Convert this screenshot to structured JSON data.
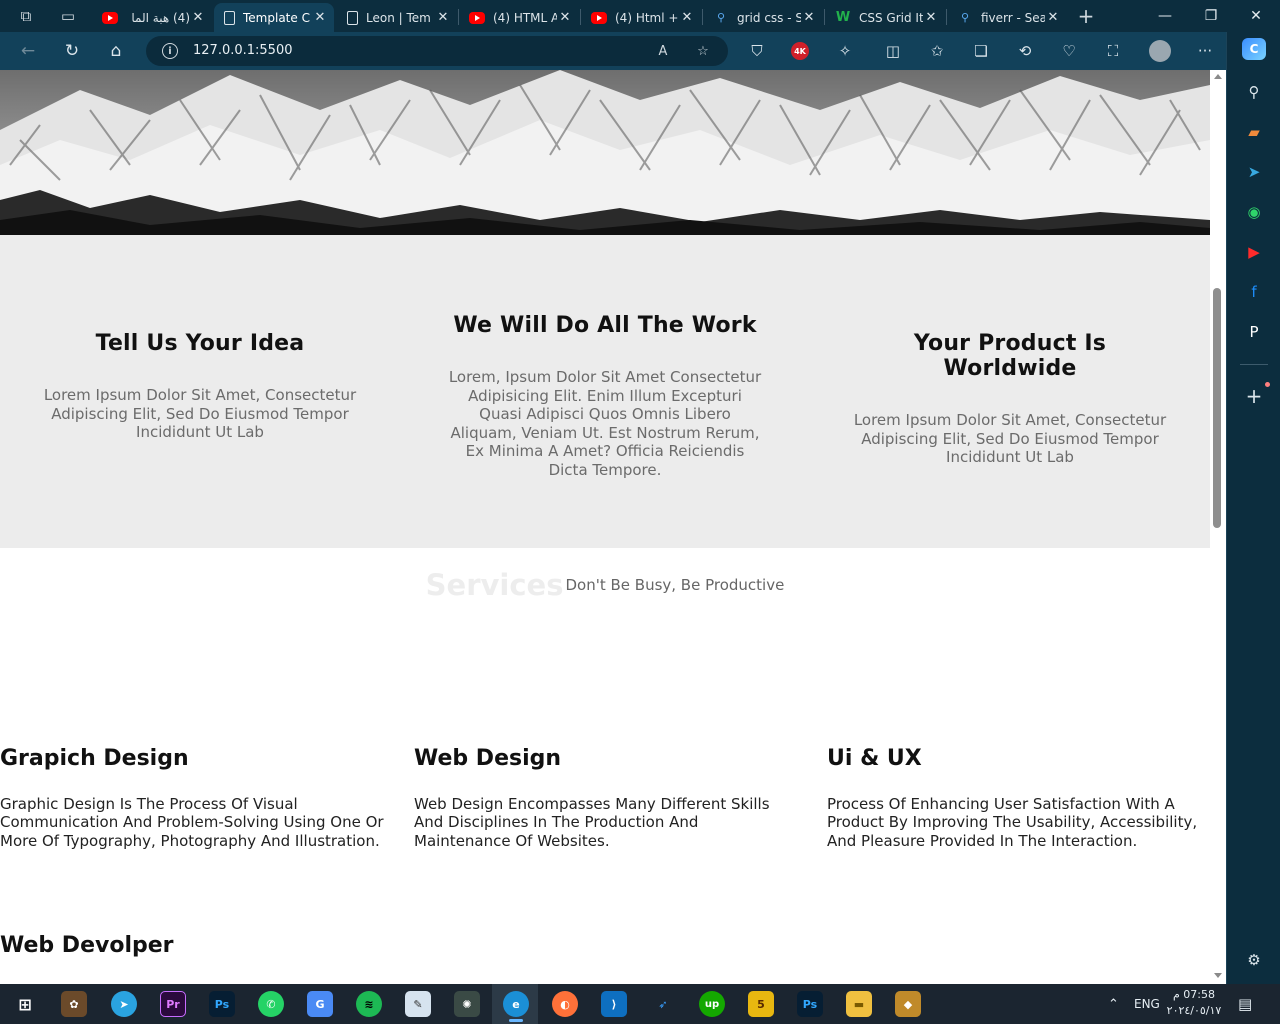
{
  "browser": {
    "tabs": [
      {
        "title": "(4) هبة الما",
        "favicon": "youtube-icon",
        "active": false
      },
      {
        "title": "Template C",
        "favicon": "document-icon",
        "active": true
      },
      {
        "title": "Leon | Tem",
        "favicon": "document-icon",
        "active": false
      },
      {
        "title": "(4) HTML A",
        "favicon": "youtube-icon",
        "active": false
      },
      {
        "title": "(4) Html +",
        "favicon": "youtube-icon",
        "active": false
      },
      {
        "title": "grid css - S",
        "favicon": "search-icon",
        "active": false
      },
      {
        "title": "CSS Grid It",
        "favicon": "w3schools-icon",
        "active": false
      },
      {
        "title": "fiverr - Sea",
        "favicon": "search-icon",
        "active": false
      }
    ],
    "address": "127.0.0.1:5500",
    "extension_badge": "4K"
  },
  "page": {
    "features": [
      {
        "title": "Tell Us Your Idea",
        "text": "Lorem Ipsum Dolor Sit Amet, Consectetur Adipiscing Elit, Sed Do Eiusmod Tempor Incididunt Ut Lab"
      },
      {
        "title": "We Will Do All The Work",
        "text": "Lorem, Ipsum Dolor Sit Amet Consectetur Adipisicing Elit. Enim Illum Excepturi Quasi Adipisci Quos Omnis Libero Aliquam, Veniam Ut. Est Nostrum Rerum, Ex Minima A Amet? Officia Reiciendis Dicta Tempore."
      },
      {
        "title": "Your Product Is Worldwide",
        "text": "Lorem Ipsum Dolor Sit Amet, Consectetur Adipiscing Elit, Sed Do Eiusmod Tempor Incididunt Ut Lab"
      }
    ],
    "services": {
      "heading": "Services",
      "subheading": "Don't Be Busy, Be Productive",
      "items": [
        {
          "title": "Grapich Design",
          "text": "Graphic Design Is The Process Of Visual Communication And Problem-Solving Using One Or More Of Typography, Photography And Illustration."
        },
        {
          "title": "Web Design",
          "text": "Web Design Encompasses Many Different Skills And Disciplines In The Production And Maintenance Of Websites."
        },
        {
          "title": "Ui & UX",
          "text": "Process Of Enhancing User Satisfaction With A Product By Improving The Usability, Accessibility, And Pleasure Provided In The Interaction."
        },
        {
          "title": "Web Devolper",
          "text": ""
        }
      ]
    }
  },
  "taskbar": {
    "apps": [
      "beta-app-icon",
      "telegram-icon",
      "premiere-icon",
      "photoshop-icon",
      "whatsapp-icon",
      "translate-icon",
      "spotify-icon",
      "paint-icon",
      "chatgpt-icon",
      "edge-icon",
      "firefox-icon",
      "vscode-icon",
      "arrow-app-icon",
      "upwork-icon",
      "html5-icon",
      "photoshop-icon",
      "file-explorer-icon",
      "winrar-icon"
    ],
    "premiere_label": "Pr",
    "photoshop_label": "Ps",
    "upwork_label": "up",
    "html5_label": "5",
    "language": "ENG",
    "time": "07:58 م",
    "date": "٢٠٢٤/٠٥/١٧"
  },
  "colors": {
    "tabbar": "#0c2d3e",
    "toolbar": "#12415a",
    "features_bg": "#ececec",
    "taskbar": "#1b2530"
  }
}
